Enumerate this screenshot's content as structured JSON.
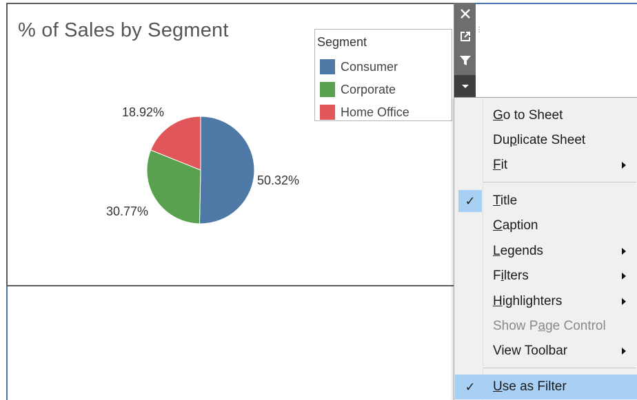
{
  "sheet": {
    "title": "% of Sales by Segment"
  },
  "legend": {
    "title": "Segment",
    "items": [
      {
        "label": "Consumer",
        "color": "#4e79a7"
      },
      {
        "label": "Corporate",
        "color": "#59a14f"
      },
      {
        "label": "Home Office",
        "color": "#e15759"
      }
    ]
  },
  "chart_data": {
    "type": "pie",
    "title": "% of Sales by Segment",
    "categories": [
      "Consumer",
      "Corporate",
      "Home Office"
    ],
    "values": [
      50.32,
      30.77,
      18.92
    ],
    "labels": [
      "50.32%",
      "30.77%",
      "18.92%"
    ],
    "colors": [
      "#4e79a7",
      "#59a14f",
      "#e15759"
    ],
    "legend_position": "top-right"
  },
  "toolbar": {
    "icons": [
      "close-icon",
      "popout-icon",
      "filter-icon",
      "dropdown-icon"
    ],
    "glyphs": [
      "✕",
      "⧉",
      "▼",
      "▾"
    ]
  },
  "menu": {
    "items": [
      {
        "label": "Go to Sheet",
        "accel": "G",
        "rest": "o to Sheet",
        "submenu": false,
        "checked": false,
        "disabled": false
      },
      {
        "label": "Duplicate Sheet",
        "pre": "Du",
        "accel": "p",
        "rest": "licate Sheet",
        "submenu": false,
        "checked": false,
        "disabled": false
      },
      {
        "label": "Fit",
        "accel": "F",
        "rest": "it",
        "submenu": true,
        "checked": false,
        "disabled": false
      },
      {
        "label": "Title",
        "accel": "T",
        "rest": "itle",
        "submenu": false,
        "checked": true,
        "disabled": false
      },
      {
        "label": "Caption",
        "accel": "C",
        "rest": "aption",
        "submenu": false,
        "checked": false,
        "disabled": false
      },
      {
        "label": "Legends",
        "accel": "L",
        "rest": "egends",
        "submenu": true,
        "checked": false,
        "disabled": false
      },
      {
        "label": "Filters",
        "pre": "F",
        "accel": "i",
        "rest": "lters",
        "submenu": true,
        "checked": false,
        "disabled": false
      },
      {
        "label": "Highlighters",
        "accel": "H",
        "rest": "ighlighters",
        "submenu": true,
        "checked": false,
        "disabled": false
      },
      {
        "label": "Show Page Control",
        "pre": "Show P",
        "accel": "a",
        "rest": "ge Control",
        "submenu": false,
        "checked": false,
        "disabled": true
      },
      {
        "label": "View Toolbar",
        "submenu": true,
        "checked": false,
        "disabled": false
      },
      {
        "label": "Use as Filter",
        "accel": "U",
        "rest": "se as Filter",
        "submenu": false,
        "checked": true,
        "disabled": false,
        "highlighted": true
      }
    ],
    "check_glyph": "✓"
  }
}
